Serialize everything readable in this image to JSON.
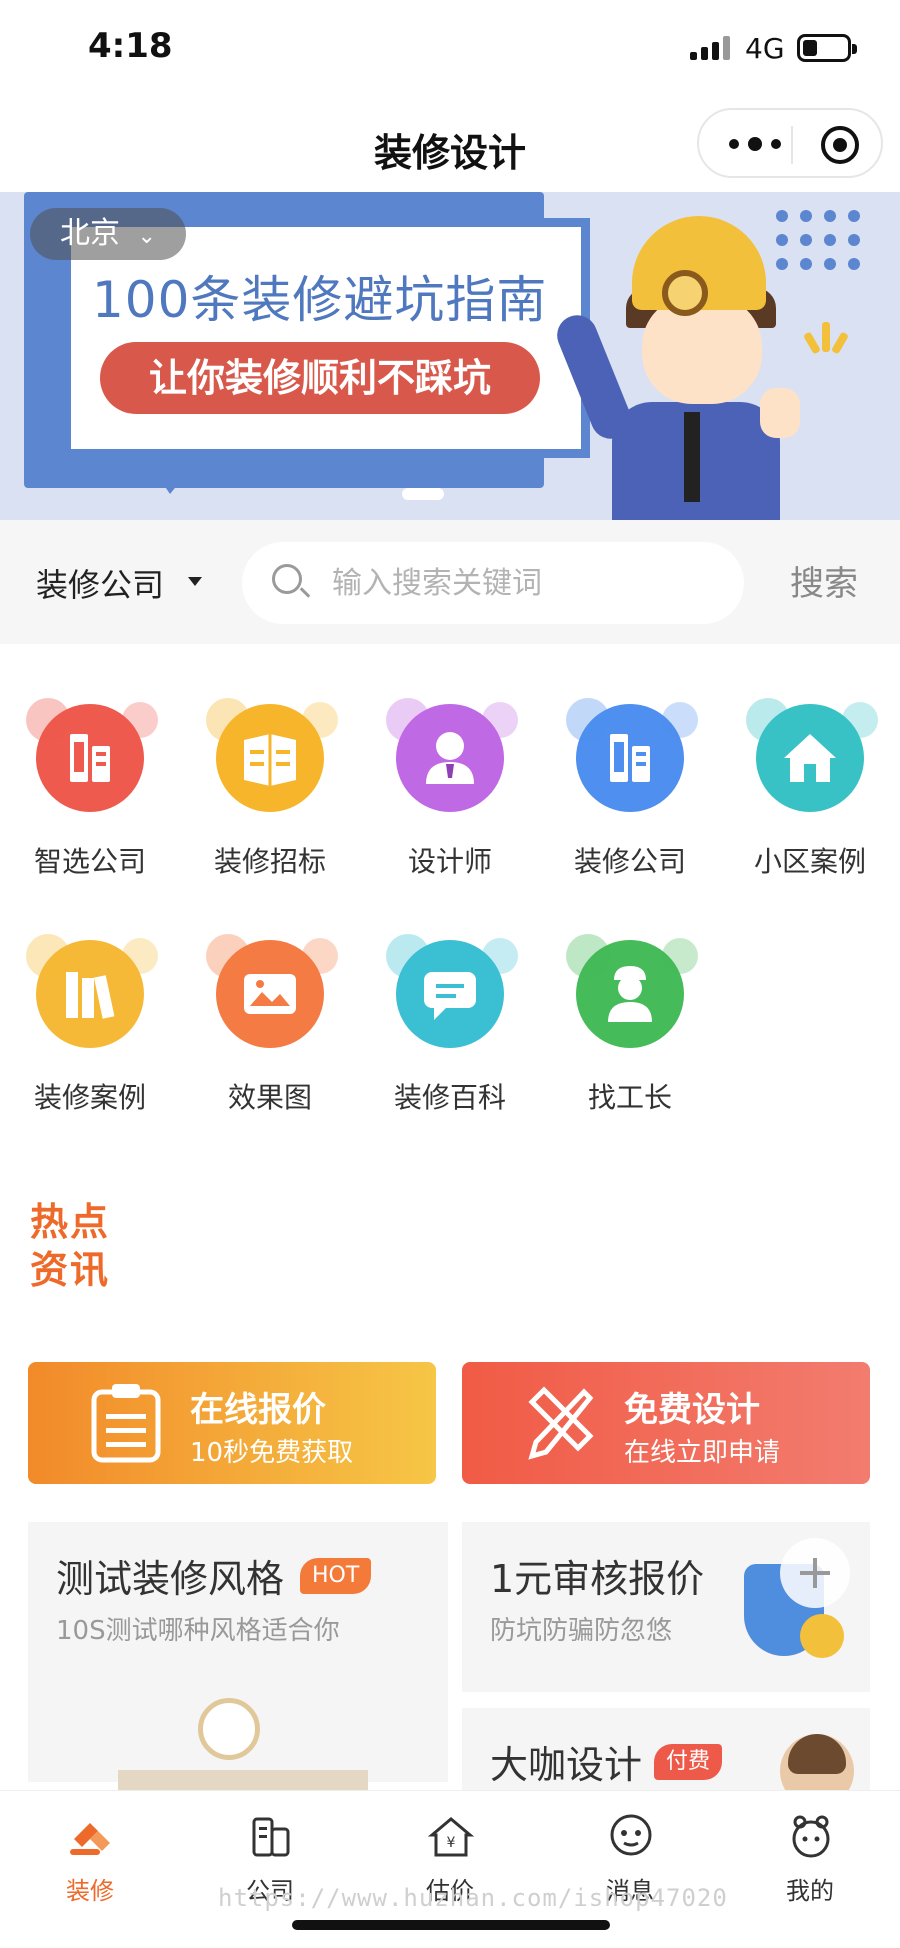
{
  "status": {
    "time": "4:18",
    "network": "4G"
  },
  "nav": {
    "title": "装修设计"
  },
  "banner": {
    "headline": "100条装修避坑指南",
    "pill": "让你装修顺利不踩坑",
    "city": "北京"
  },
  "search": {
    "category": "装修公司",
    "placeholder": "输入搜索关键词",
    "button": "搜索"
  },
  "grid": {
    "items": [
      {
        "label": "智选公司",
        "icon": "company-icon",
        "color": "#ef5a4e"
      },
      {
        "label": "装修招标",
        "icon": "bid-icon",
        "color": "#f7b52c"
      },
      {
        "label": "设计师",
        "icon": "designer-icon",
        "color": "#c069e4"
      },
      {
        "label": "装修公司",
        "icon": "company-icon",
        "color": "#4e8fef"
      },
      {
        "label": "小区案例",
        "icon": "house-icon",
        "color": "#39c2c6"
      },
      {
        "label": "装修案例",
        "icon": "books-icon",
        "color": "#f6b937"
      },
      {
        "label": "效果图",
        "icon": "image-icon",
        "color": "#f47b43"
      },
      {
        "label": "装修百科",
        "icon": "chat-icon",
        "color": "#3bbfd3"
      },
      {
        "label": "找工长",
        "icon": "worker-icon",
        "color": "#46bb5a"
      }
    ]
  },
  "hot": {
    "line1": "热点",
    "line2": "资讯"
  },
  "promos": [
    {
      "title": "在线报价",
      "subtitle": "10秒免费获取",
      "icon": "clipboard-icon"
    },
    {
      "title": "免费设计",
      "subtitle": "在线立即申请",
      "icon": "ruler-pencil-icon"
    }
  ],
  "cards": {
    "style": {
      "title": "测试装修风格",
      "tag": "HOT",
      "subtitle": "10S测试哪种风格适合你"
    },
    "audit": {
      "title": "1元审核报价",
      "subtitle": "防坑防骗防忽悠"
    },
    "master": {
      "title": "大咖设计",
      "tag": "付费"
    }
  },
  "tabbar": {
    "items": [
      {
        "label": "装修",
        "icon": "hammer-icon",
        "active": true
      },
      {
        "label": "公司",
        "icon": "building-icon",
        "active": false
      },
      {
        "label": "估价",
        "icon": "yuan-house-icon",
        "active": false
      },
      {
        "label": "消息",
        "icon": "message-icon",
        "active": false
      },
      {
        "label": "我的",
        "icon": "profile-icon",
        "active": false
      }
    ]
  },
  "watermark": "https://www.huzhan.com/ishop47020"
}
